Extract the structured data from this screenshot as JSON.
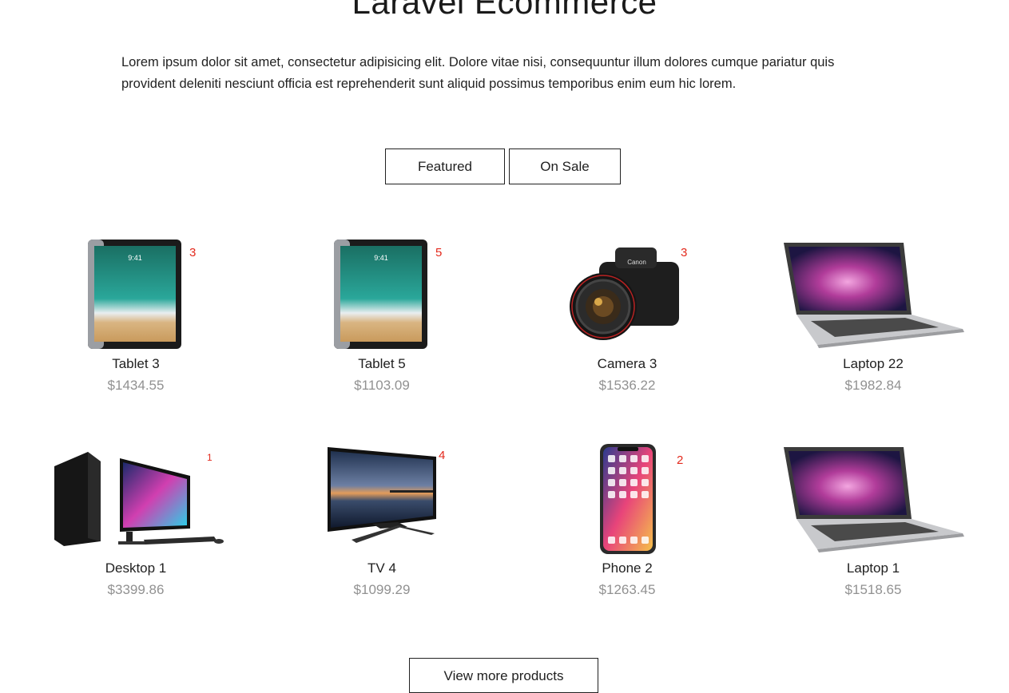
{
  "header": {
    "title": "Laravel Ecommerce"
  },
  "intro": {
    "text": "Lorem ipsum dolor sit amet, consectetur adipisicing elit. Dolore vitae nisi, consequuntur illum dolores cumque pariatur quis provident deleniti nesciunt officia est reprehenderit sunt aliquid possimus temporibus enim eum hic lorem."
  },
  "tabs": [
    {
      "label": "Featured"
    },
    {
      "label": "On Sale"
    }
  ],
  "products": [
    {
      "name": "Tablet 3",
      "price": "$1434.55",
      "badge": "3",
      "icon": "tablet-icon"
    },
    {
      "name": "Tablet 5",
      "price": "$1103.09",
      "badge": "5",
      "icon": "tablet-icon"
    },
    {
      "name": "Camera 3",
      "price": "$1536.22",
      "badge": "3",
      "icon": "camera-icon"
    },
    {
      "name": "Laptop 22",
      "price": "$1982.84",
      "badge": "",
      "icon": "laptop-icon"
    },
    {
      "name": "Desktop 1",
      "price": "$3399.86",
      "badge": "1",
      "icon": "desktop-icon"
    },
    {
      "name": "TV 4",
      "price": "$1099.29",
      "badge": "4",
      "icon": "tv-icon"
    },
    {
      "name": "Phone 2",
      "price": "$1263.45",
      "badge": "2",
      "icon": "phone-icon"
    },
    {
      "name": "Laptop 1",
      "price": "$1518.65",
      "badge": "",
      "icon": "laptop-icon"
    }
  ],
  "footer": {
    "more_label": "View more products"
  },
  "colors": {
    "badge": "#e3291c",
    "price": "#919191",
    "text": "#212121"
  }
}
